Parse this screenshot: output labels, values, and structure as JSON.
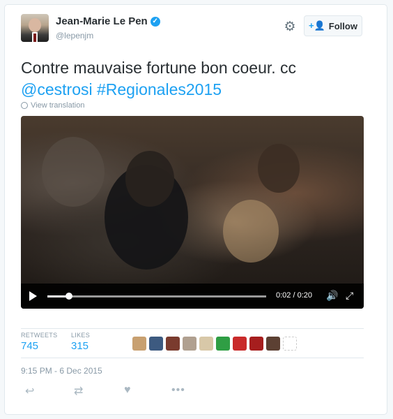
{
  "author": {
    "name": "Jean-Marie Le Pen",
    "handle": "@lepenjm"
  },
  "follow_button": {
    "label": "Follow"
  },
  "tweet": {
    "text": "Contre mauvaise fortune bon coeur.  cc",
    "mention": "@cestrosi",
    "hashtag": "#Regionales2015",
    "translate_label": "View translation"
  },
  "video": {
    "time": "0:02 / 0:20",
    "progress": 0.1
  },
  "stats": {
    "retweets_label": "RETWEETS",
    "retweets_value": "745",
    "likes_label": "LIKES",
    "likes_value": "315"
  },
  "date": "9:15 PM - 6 Dec 2015",
  "colors": {
    "accent": "#1da1f2",
    "muted": "#8899a6"
  }
}
